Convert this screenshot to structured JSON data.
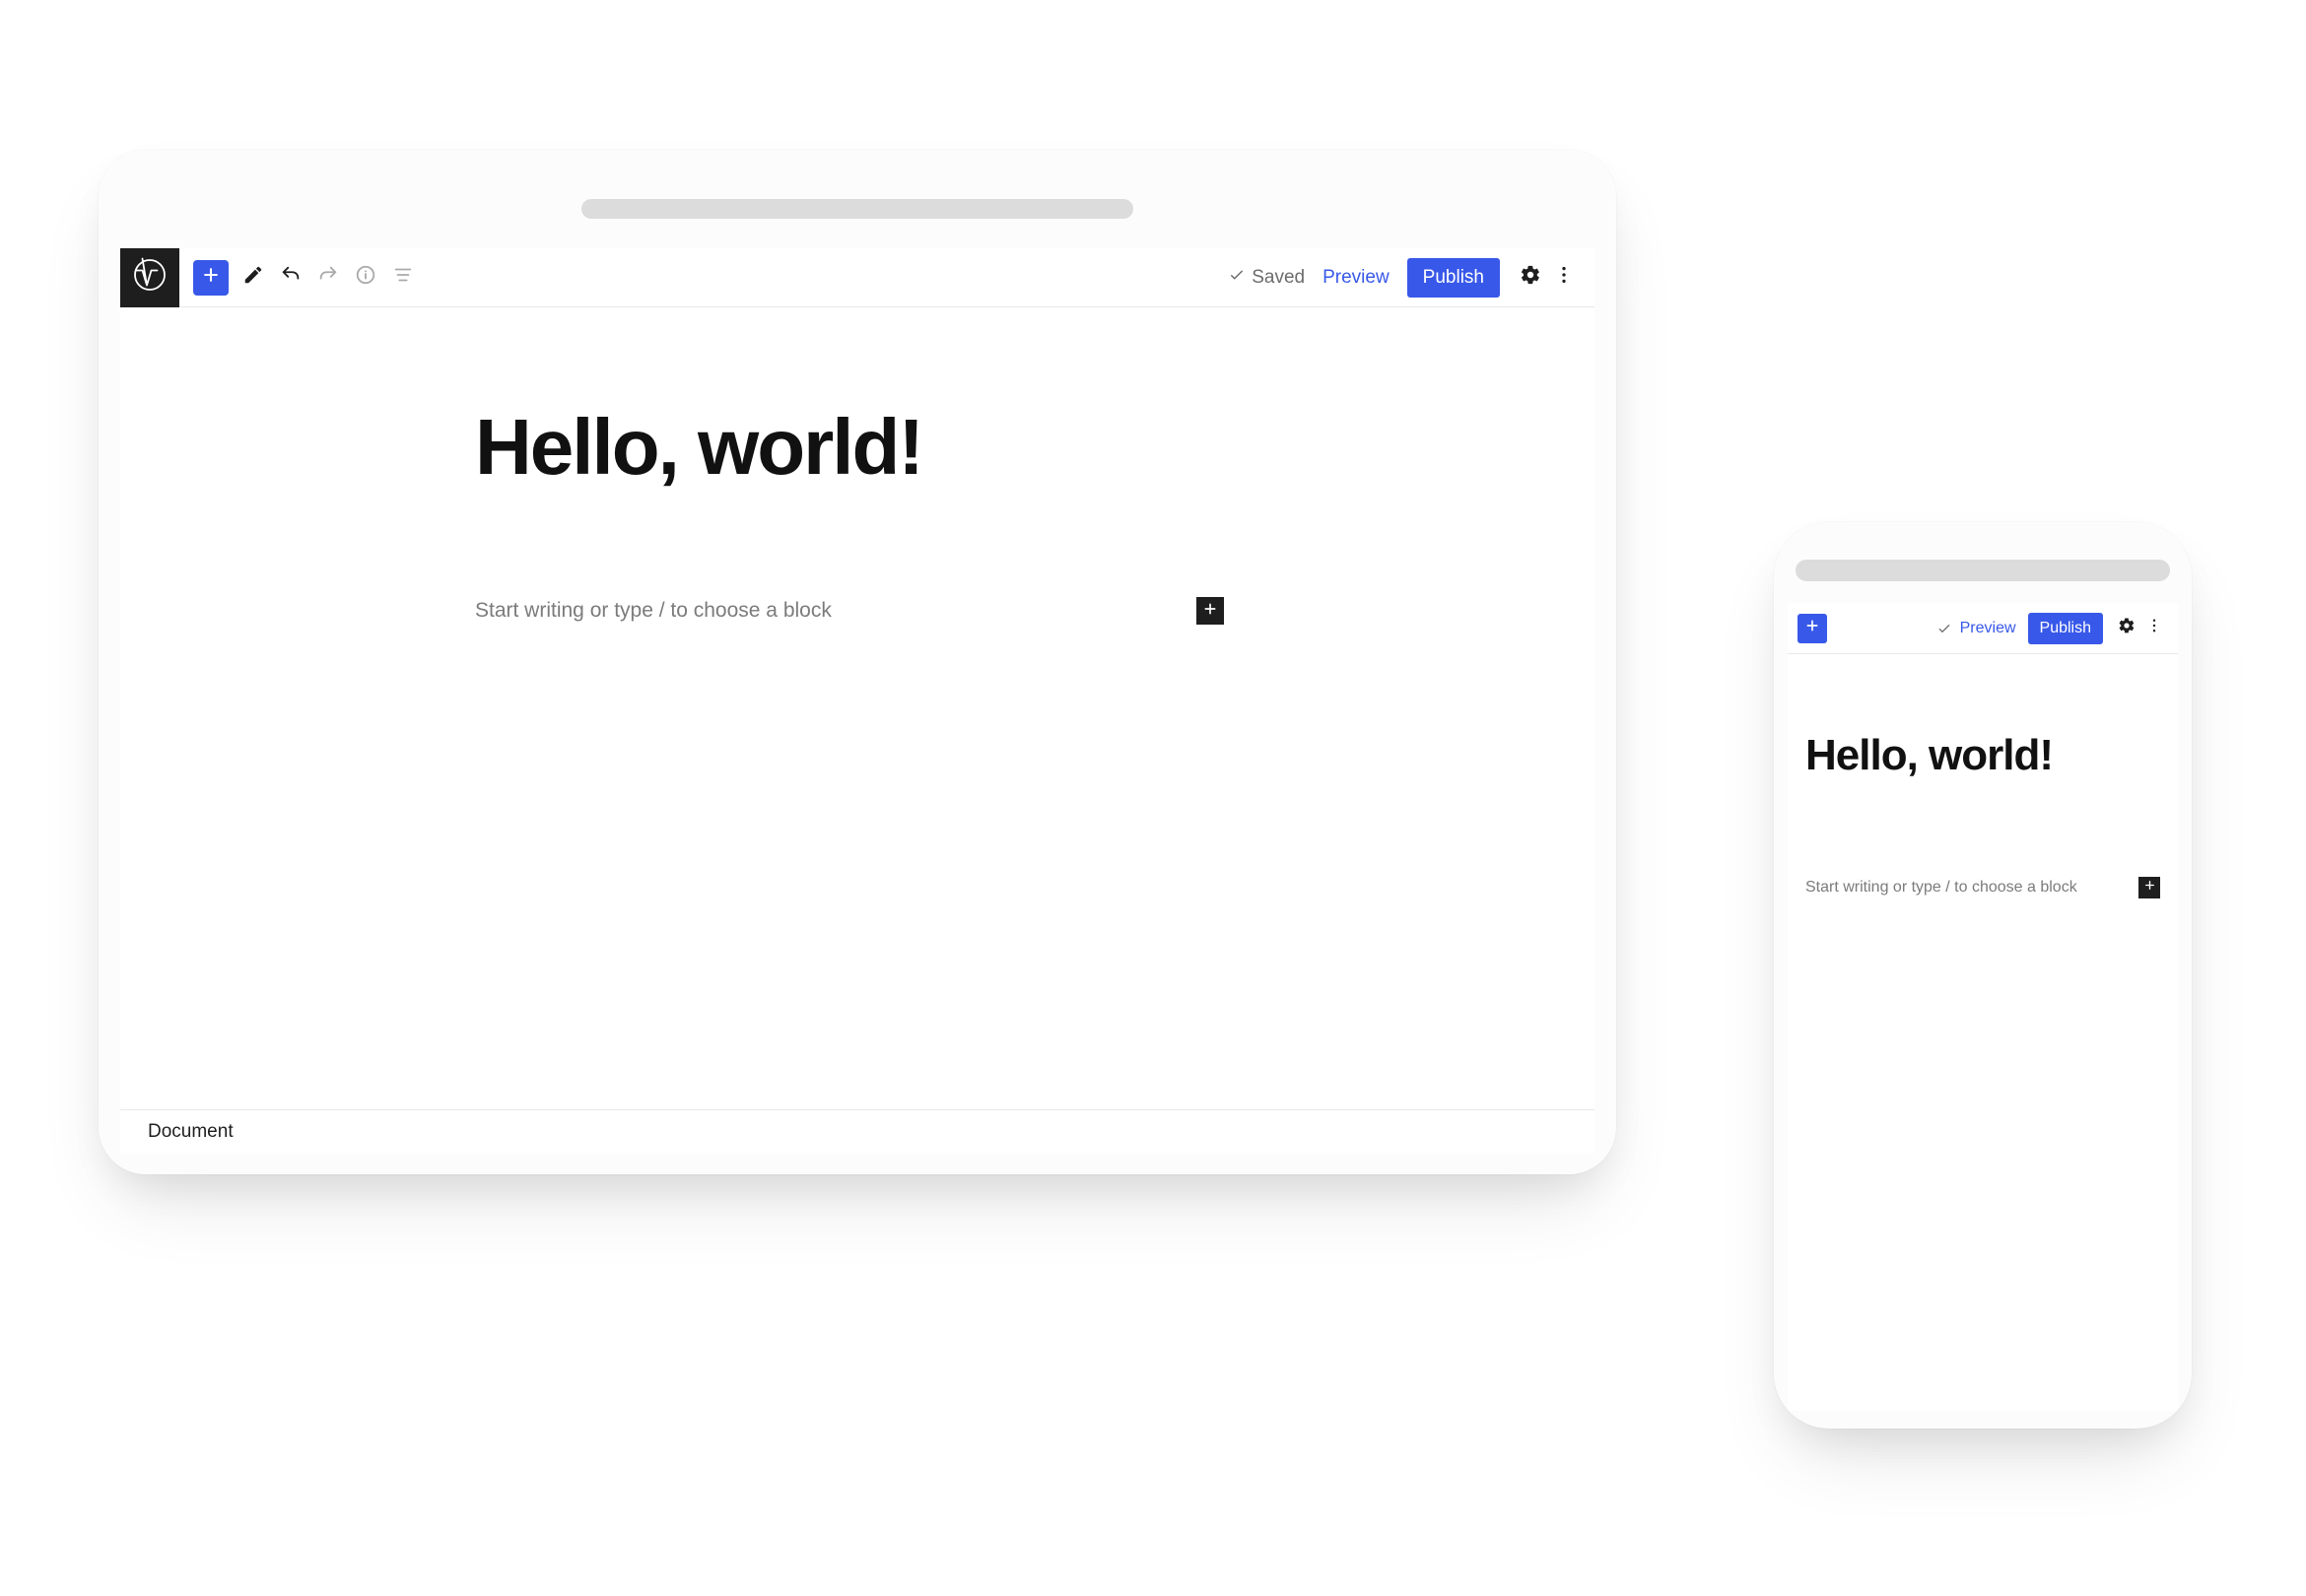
{
  "desktop": {
    "toolbar": {
      "saved_label": "Saved",
      "preview_label": "Preview",
      "publish_label": "Publish"
    },
    "editor": {
      "title": "Hello, world!",
      "block_placeholder": "Start writing or type / to choose a block"
    },
    "breadcrumb": "Document"
  },
  "mobile": {
    "toolbar": {
      "preview_label": "Preview",
      "publish_label": "Publish"
    },
    "editor": {
      "title": "Hello, world!",
      "block_placeholder": "Start writing or type / to choose a block"
    }
  },
  "colors": {
    "accent": "#3858e9",
    "dark": "#1e1e1e"
  }
}
